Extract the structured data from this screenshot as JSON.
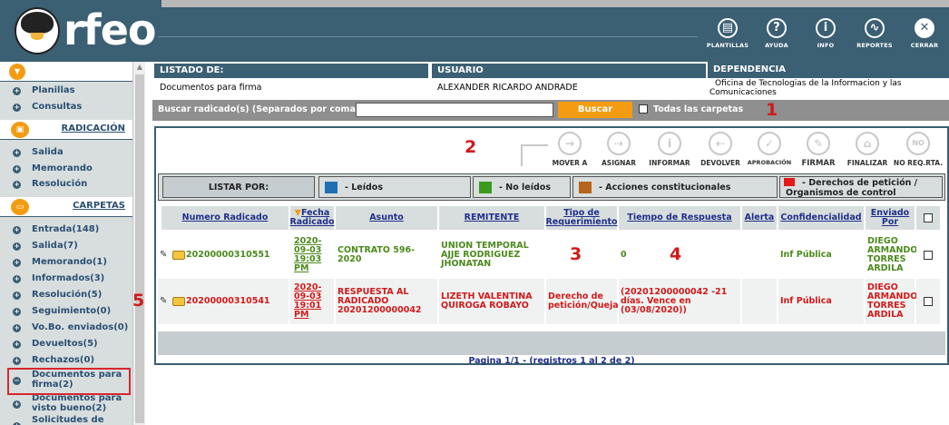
{
  "app": {
    "logo_text": "rfeo"
  },
  "header_buttons": [
    {
      "label": "PLANTILLAS",
      "icon": "template-icon"
    },
    {
      "label": "AYUDA",
      "icon": "help-icon"
    },
    {
      "label": "INFO",
      "icon": "info-icon"
    },
    {
      "label": "REPORTES",
      "icon": "reports-icon"
    },
    {
      "label": "CERRAR",
      "icon": "close-icon"
    }
  ],
  "sidebar": {
    "top_items": [
      "Planillas",
      "Consultas"
    ],
    "radicacion_title": "RADICACIÓN",
    "radicacion_items": [
      "Salida",
      "Memorando",
      "Resolución"
    ],
    "carpetas_title": "CARPETAS",
    "carpetas_items": [
      "Entrada(148)",
      "Salida(7)",
      "Memorando(1)",
      "Informados(3)",
      "Resolución(5)",
      "Seguimiento(0)",
      "Vo.Bo. enviados(0)",
      "Devueltos(5)",
      "Rechazos(0)",
      "Documentos para firma(2)",
      "Documentos para visto bueno(2)",
      "Solicitudes de"
    ]
  },
  "info": {
    "listado_header": "LISTADO DE:",
    "listado_value": "Documentos para firma",
    "usuario_header": "USUARIO",
    "usuario_value": "ALEXANDER RICARDO ANDRADE",
    "dependencia_header": "DEPENDENCIA",
    "dependencia_value": "Oficina de Tecnologias de la Informacion y las Comunicaciones"
  },
  "search": {
    "label": "Buscar radicado(s) (Separados por coma)",
    "input_value": "",
    "button_label": "Buscar",
    "checkbox_label": "Todas las carpetas"
  },
  "actions": [
    {
      "label": "MOVER A",
      "icon": "arrow-right-icon"
    },
    {
      "label": "ASIGNAR",
      "icon": "assign-icon"
    },
    {
      "label": "INFORMAR",
      "icon": "info-icon"
    },
    {
      "label": "DEVOLVER",
      "icon": "return-icon"
    },
    {
      "label": "APROBACIÓN",
      "icon": "check-icon"
    },
    {
      "label": "FIRMAR",
      "icon": "sign-icon"
    },
    {
      "label": "FINALIZAR",
      "icon": "finalize-icon"
    },
    {
      "label": "NO REQ.RTA.",
      "icon": "no-reply-icon"
    }
  ],
  "legend": {
    "listar_por": "LISTAR POR:",
    "items": [
      {
        "label": "- Leídos",
        "color": "#1f6fb3"
      },
      {
        "label": "- No leídos",
        "color": "#3a9a1c"
      },
      {
        "label": "- Acciones constitucionales",
        "color": "#b5651d"
      },
      {
        "label": "- Derechos de petición / Organismos de control",
        "color": "#e81818"
      }
    ]
  },
  "table": {
    "headers": {
      "numero": "Numero Radicado",
      "fecha": "Fecha Radicado",
      "asunto": "Asunto",
      "remitente": "REMITENTE",
      "tipo": "Tipo de Requerimiento",
      "tiempo": "Tiempo de Respuesta",
      "alerta": "Alerta",
      "confidencialidad": "Confidencialidad",
      "enviado": "Enviado Por"
    },
    "rows": [
      {
        "numero": "20200000310551",
        "fecha": "2020-09-03 19:03 PM",
        "asunto": "CONTRATO 596-2020",
        "remitente": "UNION TEMPORAL AJJE RODRIGUEZ JHONATAN",
        "tipo": "",
        "tiempo": "0",
        "alerta": "",
        "confidencialidad": "Inf Pública",
        "enviado": "DIEGO ARMANDO TORRES ARDILA"
      },
      {
        "numero": "20200000310541",
        "fecha": "2020-09-03 19:01 PM",
        "asunto": "RESPUESTA AL RADICADO 20201200000042",
        "remitente": "LIZETH VALENTINA QUIROGA ROBAYO",
        "tipo": "Derecho de petición/Queja",
        "tiempo": "(20201200000042 -21 días. Vence en (03/08/2020))",
        "alerta": "",
        "confidencialidad": "Inf Pública",
        "enviado": "DIEGO ARMANDO TORRES ARDILA"
      }
    ]
  },
  "pager": {
    "text": "Pagina 1/1   -   (registros 1 al 2 de 2)"
  },
  "annotations": {
    "a1": "1",
    "a2": "2",
    "a3": "3",
    "a4": "4",
    "a5": "5"
  }
}
